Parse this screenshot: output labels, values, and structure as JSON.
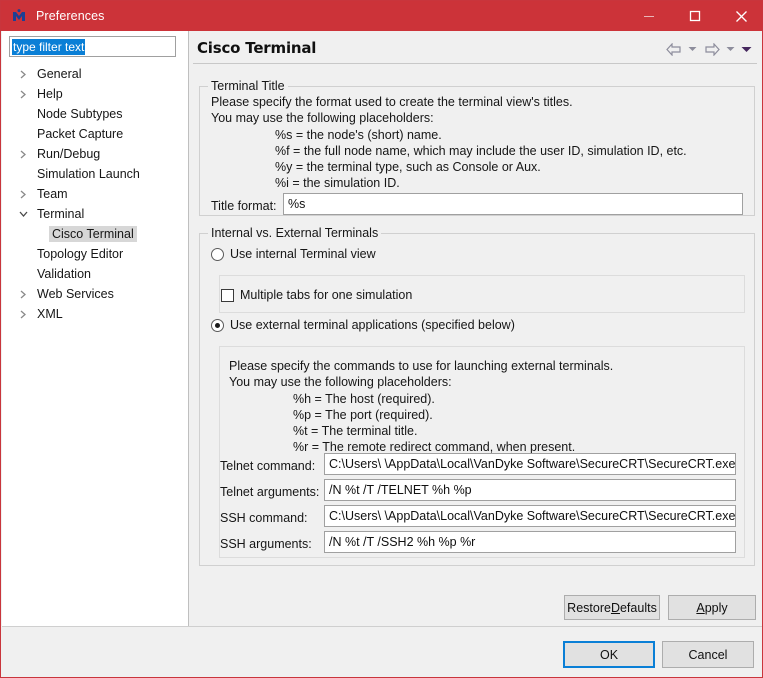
{
  "window": {
    "title": "Preferences",
    "icon": "app-logo-icon",
    "accent_red": "#cc3339",
    "minimize_label": "Minimize",
    "maximize_label": "Maximize",
    "close_label": "Close"
  },
  "sidebar": {
    "filter": {
      "value": "type filter text",
      "placeholder": "type filter text"
    },
    "items": [
      {
        "label": "General",
        "expandable": true,
        "expanded": false,
        "child": false,
        "selected": false
      },
      {
        "label": "Help",
        "expandable": true,
        "expanded": false,
        "child": false,
        "selected": false
      },
      {
        "label": "Node Subtypes",
        "expandable": false,
        "expanded": false,
        "child": false,
        "selected": false
      },
      {
        "label": "Packet Capture",
        "expandable": false,
        "expanded": false,
        "child": false,
        "selected": false
      },
      {
        "label": "Run/Debug",
        "expandable": true,
        "expanded": false,
        "child": false,
        "selected": false
      },
      {
        "label": "Simulation Launch",
        "expandable": false,
        "expanded": false,
        "child": false,
        "selected": false
      },
      {
        "label": "Team",
        "expandable": true,
        "expanded": false,
        "child": false,
        "selected": false
      },
      {
        "label": "Terminal",
        "expandable": true,
        "expanded": true,
        "child": false,
        "selected": false
      },
      {
        "label": "Cisco Terminal",
        "expandable": false,
        "expanded": false,
        "child": true,
        "selected": true
      },
      {
        "label": "Topology Editor",
        "expandable": false,
        "expanded": false,
        "child": false,
        "selected": false
      },
      {
        "label": "Validation",
        "expandable": false,
        "expanded": false,
        "child": false,
        "selected": false
      },
      {
        "label": "Web Services",
        "expandable": true,
        "expanded": false,
        "child": false,
        "selected": false
      },
      {
        "label": "XML",
        "expandable": true,
        "expanded": false,
        "child": false,
        "selected": false
      }
    ]
  },
  "page": {
    "title": "Cisco Terminal",
    "nav": {
      "back_icon": "arrow-left-icon",
      "back_menu_icon": "chevron-down-icon",
      "forward_icon": "arrow-right-icon",
      "forward_menu_icon": "chevron-down-icon",
      "menu_icon": "chevron-down-filled-icon"
    }
  },
  "terminal_title_group": {
    "legend": "Terminal Title",
    "description_line1": "Please specify the format used to create the terminal view's titles.",
    "description_line2": "You may use the following placeholders:",
    "placeholders": [
      "%s = the node's (short) name.",
      "%f = the full node name, which may include the user ID, simulation ID, etc.",
      "%y = the terminal type, such as Console or Aux.",
      "%i = the simulation ID."
    ],
    "title_format_label": "Title format:",
    "title_format_value": "%s"
  },
  "internal_external_group": {
    "legend": "Internal vs. External Terminals",
    "radio_internal": {
      "label": "Use internal Terminal view",
      "selected": false
    },
    "checkbox_multiple_tabs": {
      "label": "Multiple tabs for one simulation",
      "checked": false
    },
    "radio_external": {
      "label": "Use external terminal applications (specified below)",
      "selected": true
    },
    "external": {
      "description_line1": "Please specify the commands to use for launching external terminals.",
      "description_line2": "You may use the following placeholders:",
      "placeholders": [
        "%h = The host (required).",
        "%p = The port (required).",
        "%t = The terminal title.",
        "%r = The remote redirect command, when present."
      ],
      "fields": [
        {
          "label": "Telnet command:",
          "value": "C:\\Users\\   \\AppData\\Local\\VanDyke Software\\SecureCRT\\SecureCRT.exe"
        },
        {
          "label": "Telnet arguments:",
          "value": "/N %t /T /TELNET %h %p"
        },
        {
          "label": "SSH command:",
          "value": "C:\\Users\\   \\AppData\\Local\\VanDyke Software\\SecureCRT\\SecureCRT.exe"
        },
        {
          "label": "SSH arguments:",
          "value": "/N %t /T /SSH2 %h %p %r"
        }
      ]
    }
  },
  "buttons": {
    "restore_defaults_pre": "Restore ",
    "restore_defaults_mnemonic": "D",
    "restore_defaults_post": "efaults",
    "apply_mnemonic": "A",
    "apply_post": "pply",
    "ok": "OK",
    "cancel": "Cancel"
  }
}
